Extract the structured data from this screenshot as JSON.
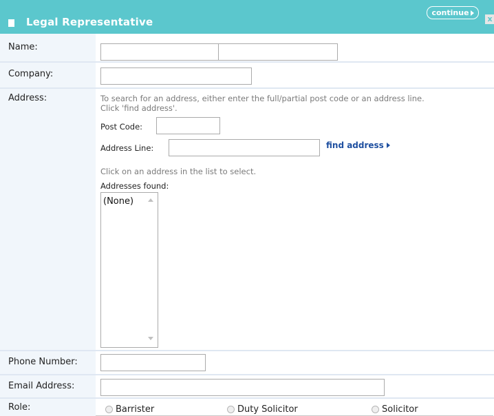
{
  "header": {
    "title": "Legal Representative",
    "continue_label": "continue",
    "close_label": "x"
  },
  "form": {
    "name": {
      "label": "Name:",
      "first_value": "",
      "last_value": ""
    },
    "company": {
      "label": "Company:",
      "value": ""
    },
    "address": {
      "label": "Address:",
      "help_line1": "To search for an address, either enter the full/partial post code or an address line.",
      "help_line2": "Click 'find address'.",
      "post_code_label": "Post Code:",
      "post_code_value": "",
      "address_line_label": "Address Line:",
      "address_line_value": "",
      "find_label": "find address",
      "select_help": "Click on an address in the list to select.",
      "found_label": "Addresses found:",
      "found_items": [
        "(None)"
      ]
    },
    "phone": {
      "label": "Phone Number:",
      "value": ""
    },
    "email": {
      "label": "Email Address:",
      "value": ""
    },
    "role": {
      "label": "Role:",
      "options": [
        "Barrister",
        "Duty Solicitor",
        "Solicitor"
      ]
    }
  },
  "colors": {
    "header_bg": "#5bc7cd",
    "label_bg": "#f1f6fb",
    "link": "#1e4fa0"
  }
}
